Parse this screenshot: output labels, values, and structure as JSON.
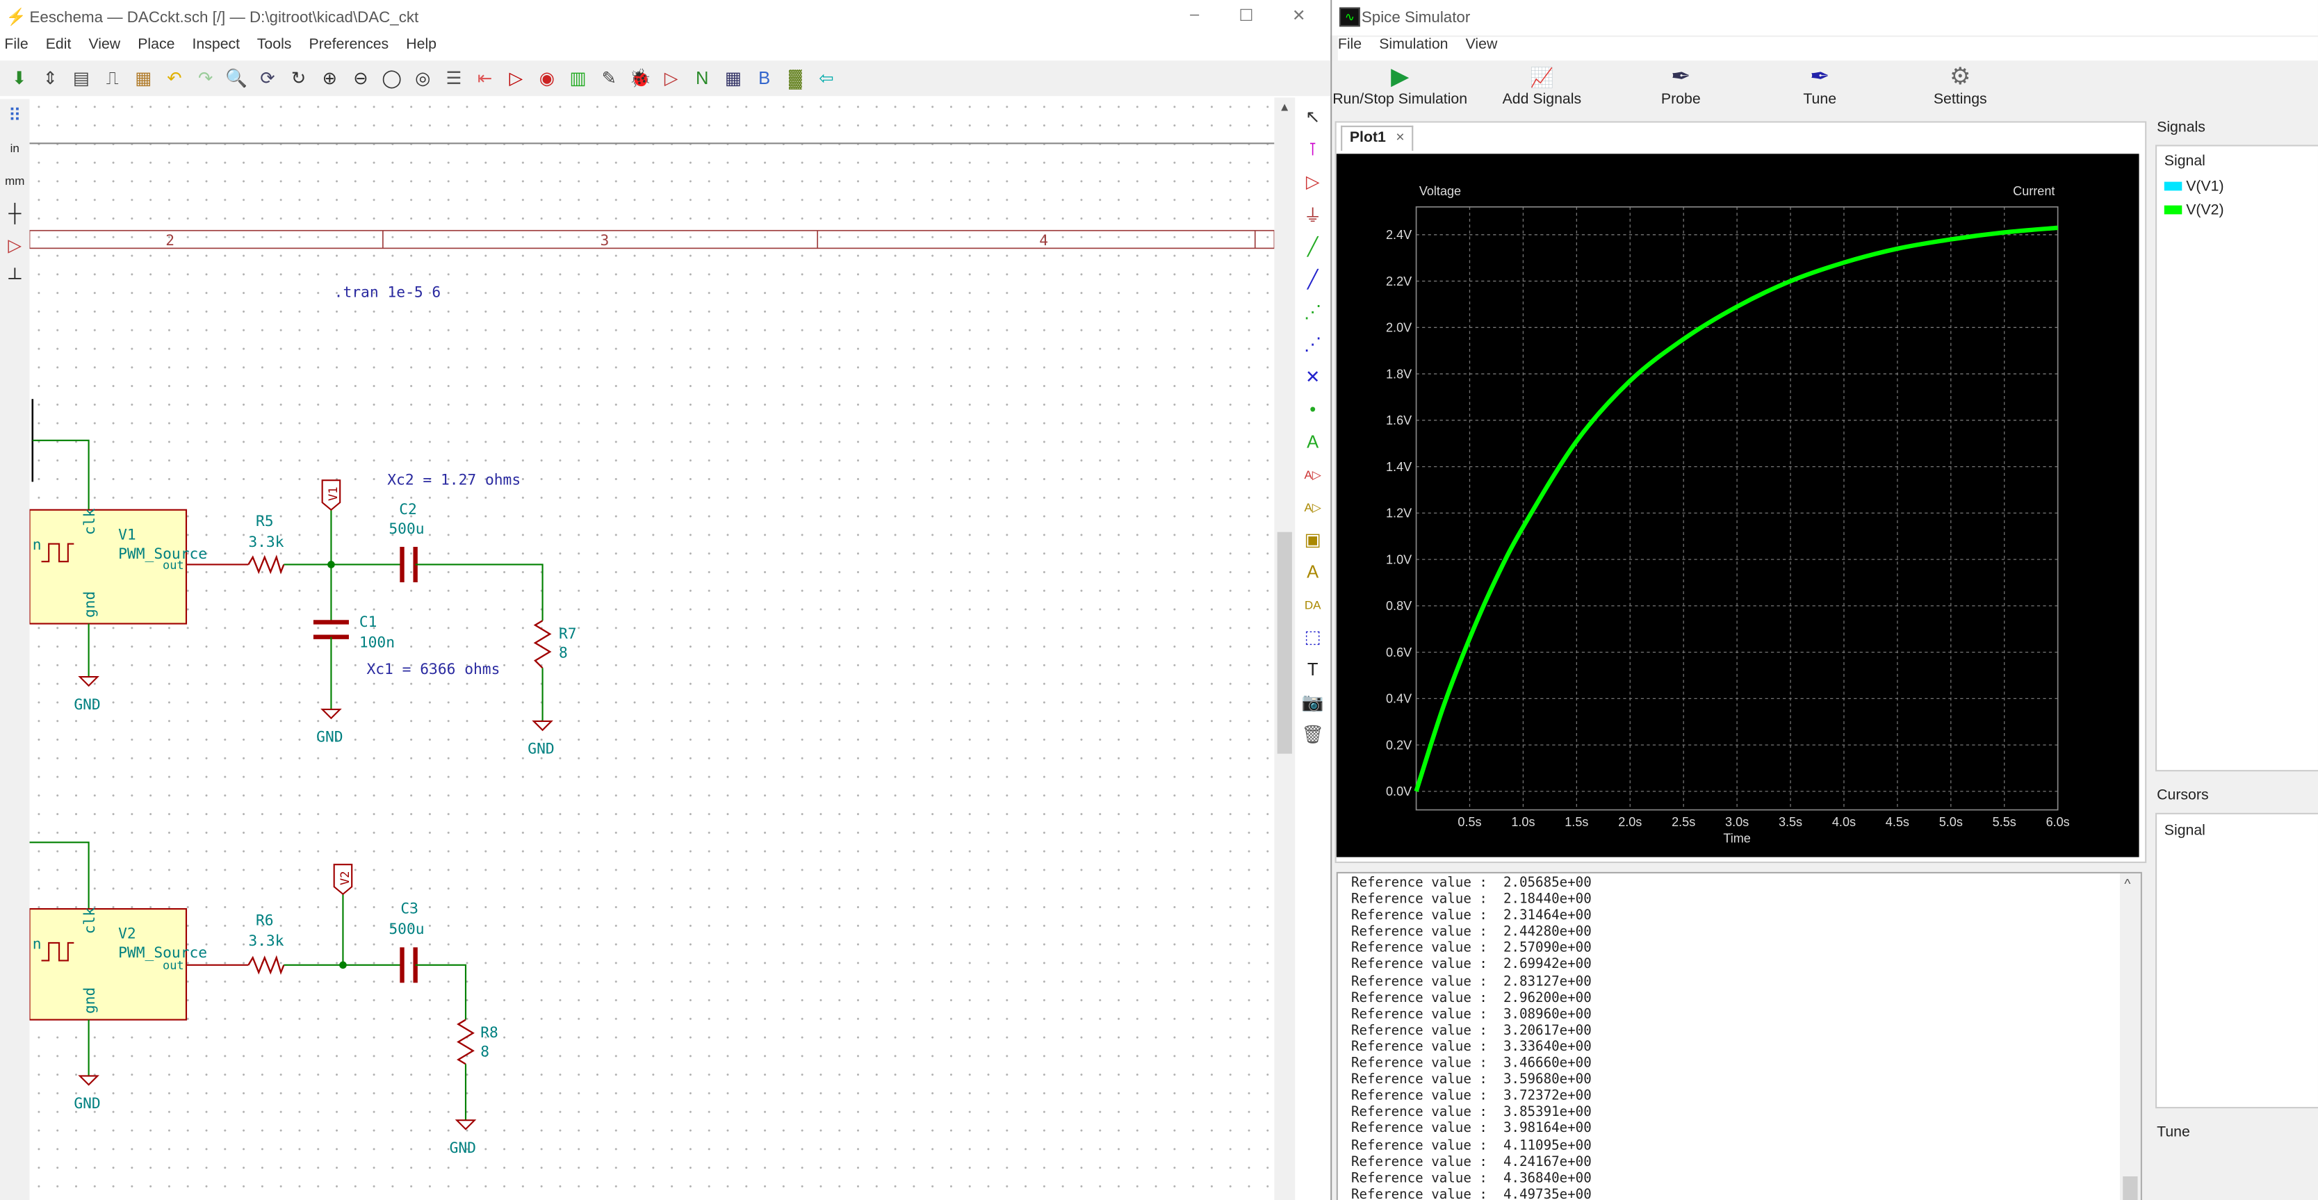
{
  "eeschema": {
    "title": "Eeschema — DACckt.sch [/] — D:\\gitroot\\kicad\\DAC_ckt",
    "window_controls": [
      "–",
      "☐",
      "✕"
    ],
    "menu": [
      "File",
      "Edit",
      "View",
      "Place",
      "Inspect",
      "Tools",
      "Preferences",
      "Help"
    ],
    "toolbar_icons": [
      {
        "name": "save-icon",
        "g": "⬇",
        "c": "#2a8a2a"
      },
      {
        "name": "page-settings-icon",
        "g": "⇕",
        "c": "#444"
      },
      {
        "name": "print-icon",
        "g": "▤",
        "c": "#444"
      },
      {
        "name": "plot-icon",
        "g": "⎍",
        "c": "#444"
      },
      {
        "name": "paste-icon",
        "g": "▦",
        "c": "#b07b2a"
      },
      {
        "name": "undo-icon",
        "g": "↶",
        "c": "#e0b000"
      },
      {
        "name": "redo-icon",
        "g": "↷",
        "c": "#9c9"
      },
      {
        "name": "find-icon",
        "g": "🔍",
        "c": "#446"
      },
      {
        "name": "find-replace-icon",
        "g": "⟳",
        "c": "#446"
      },
      {
        "name": "redraw-icon",
        "g": "↻",
        "c": "#333"
      },
      {
        "name": "zoom-in-icon",
        "g": "⊕",
        "c": "#333"
      },
      {
        "name": "zoom-out-icon",
        "g": "⊖",
        "c": "#333"
      },
      {
        "name": "zoom-fit-icon",
        "g": "◯",
        "c": "#333"
      },
      {
        "name": "zoom-selection-icon",
        "g": "◎",
        "c": "#333"
      },
      {
        "name": "hierarchy-icon",
        "g": "☰",
        "c": "#555"
      },
      {
        "name": "leave-sheet-icon",
        "g": "⇤",
        "c": "#d55"
      },
      {
        "name": "symbol-editor-icon",
        "g": "▷",
        "c": "#b00"
      },
      {
        "name": "symbol-browser-icon",
        "g": "◉",
        "c": "#c22"
      },
      {
        "name": "footprint-assign-icon",
        "g": "▥",
        "c": "#2a2"
      },
      {
        "name": "annotate-icon",
        "g": "✎",
        "c": "#444"
      },
      {
        "name": "erc-icon",
        "g": "🐞",
        "c": "#a00"
      },
      {
        "name": "simulator-icon",
        "g": "▷",
        "c": "#b33"
      },
      {
        "name": "netlist-icon",
        "g": "N",
        "c": "#2a8a2a"
      },
      {
        "name": "bom-table-icon",
        "g": "▦",
        "c": "#336"
      },
      {
        "name": "bom-icon",
        "g": "B",
        "c": "#36c"
      },
      {
        "name": "pcbnew-icon",
        "g": "▓",
        "c": "#5a7a10"
      },
      {
        "name": "back-annotate-icon",
        "g": "⇦",
        "c": "#0aa"
      }
    ],
    "left_tools": [
      {
        "name": "grid-toggle-icon",
        "g": "⠿",
        "c": "#36c"
      },
      {
        "name": "units-inch-icon",
        "g": "in",
        "c": "#222"
      },
      {
        "name": "units-mm-icon",
        "g": "mm",
        "c": "#222"
      },
      {
        "name": "cursor-shape-icon",
        "g": "┼",
        "c": "#222"
      },
      {
        "name": "hidden-pins-icon",
        "g": "▷",
        "c": "#b33"
      },
      {
        "name": "wire-angle-icon",
        "g": "┴",
        "c": "#222"
      }
    ],
    "right_tools": [
      {
        "name": "select-icon",
        "g": "↖",
        "c": "#333"
      },
      {
        "name": "highlight-net-icon",
        "g": "⊺",
        "c": "#c0c"
      },
      {
        "name": "add-symbol-icon",
        "g": "▷",
        "c": "#c33"
      },
      {
        "name": "add-power-icon",
        "g": "⏚",
        "c": "#a33"
      },
      {
        "name": "add-wire-icon",
        "g": "╱",
        "c": "#2a2"
      },
      {
        "name": "add-bus-icon",
        "g": "╱",
        "c": "#22c"
      },
      {
        "name": "wire-bus-entry-icon",
        "g": "⋰",
        "c": "#2a2"
      },
      {
        "name": "bus-bus-entry-icon",
        "g": "⋰",
        "c": "#22c"
      },
      {
        "name": "no-connect-icon",
        "g": "✕",
        "c": "#22c"
      },
      {
        "name": "add-junction-icon",
        "g": "•",
        "c": "#2a2"
      },
      {
        "name": "add-label-icon",
        "g": "A",
        "c": "#2a2"
      },
      {
        "name": "add-global-label-icon",
        "g": "A▷",
        "c": "#c33"
      },
      {
        "name": "add-hier-label-icon",
        "g": "A▷",
        "c": "#a80"
      },
      {
        "name": "add-sheet-icon",
        "g": "▣",
        "c": "#a80"
      },
      {
        "name": "import-sheet-pin-icon",
        "g": "A",
        "c": "#a80"
      },
      {
        "name": "add-sheet-pin-icon",
        "g": "DA",
        "c": "#a80"
      },
      {
        "name": "add-graphic-line-icon",
        "g": "⬚",
        "c": "#22c"
      },
      {
        "name": "add-text-icon",
        "g": "T",
        "c": "#222"
      },
      {
        "name": "add-image-icon",
        "g": "📷",
        "c": "#333"
      },
      {
        "name": "delete-icon",
        "g": "🗑",
        "c": "#555"
      }
    ],
    "sheet_columns": [
      "2",
      "3",
      "4"
    ],
    "directive": ".tran 1e-5 6",
    "circuit1": {
      "source_ref": "V1",
      "source_value": "PWM_Source",
      "pin_clk": "clk",
      "pin_gnd": "gnd",
      "pin_out": "out",
      "pin_n": "n",
      "r_ref": "R5",
      "r_value": "3.3k",
      "net_label": "V1",
      "c_series_ref": "C2",
      "c_series_value": "500u",
      "c_shunt_ref": "C1",
      "c_shunt_value": "100n",
      "load_ref": "R7",
      "load_value": "8",
      "note_xc2": "Xc2 = 1.27 ohms",
      "note_xc1": "Xc1 = 6366 ohms",
      "gnd": "GND"
    },
    "circuit2": {
      "source_ref": "V2",
      "source_value": "PWM_Source",
      "pin_clk": "clk",
      "pin_gnd": "gnd",
      "pin_out": "out",
      "pin_n": "n",
      "r_ref": "R6",
      "r_value": "3.3k",
      "net_label": "V2",
      "c_series_ref": "C3",
      "c_series_value": "500u",
      "load_ref": "R8",
      "load_value": "8",
      "gnd": "GND"
    }
  },
  "spice": {
    "title": "Spice Simulator",
    "window_controls": [
      "–",
      "☐",
      "✕"
    ],
    "menu": [
      "File",
      "Simulation",
      "View"
    ],
    "toolbar": [
      {
        "label": "Run/Stop Simulation",
        "icon": "play-icon",
        "g": "▶",
        "c": "#1a9a3a"
      },
      {
        "label": "Add Signals",
        "icon": "add-signals-icon",
        "g": "📈",
        "c": "#a33"
      },
      {
        "label": "Probe",
        "icon": "probe-icon",
        "g": "✒",
        "c": "#335"
      },
      {
        "label": "Tune",
        "icon": "tune-icon",
        "g": "✒",
        "c": "#22a"
      },
      {
        "label": "Settings",
        "icon": "settings-icon",
        "g": "⚙",
        "c": "#666"
      }
    ],
    "plot_tab": "Plot1",
    "signals_label": "Signals",
    "signals_header": "Signal",
    "signals": [
      {
        "name": "V(V1)",
        "color": "#00e5ff"
      },
      {
        "name": "V(V2)",
        "color": "#00ff00"
      }
    ],
    "cursors_label": "Cursors",
    "cursors_header": "Signal",
    "tune_label": "Tune",
    "console_lines": [
      "Reference value :  2.05685e+00",
      "Reference value :  2.18440e+00",
      "Reference value :  2.31464e+00",
      "Reference value :  2.44280e+00",
      "Reference value :  2.57090e+00",
      "Reference value :  2.69942e+00",
      "Reference value :  2.83127e+00",
      "Reference value :  2.96200e+00",
      "Reference value :  3.08960e+00",
      "Reference value :  3.20617e+00",
      "Reference value :  3.33640e+00",
      "Reference value :  3.46660e+00",
      "Reference value :  3.59680e+00",
      "Reference value :  3.72372e+00",
      "Reference value :  3.85391e+00",
      "Reference value :  3.98164e+00",
      "Reference value :  4.11095e+00",
      "Reference value :  4.24167e+00",
      "Reference value :  4.36840e+00",
      "Reference value :  4.49735e+00"
    ]
  },
  "chart_data": {
    "type": "line",
    "xlabel": "Time",
    "ylabel": "Voltage",
    "y2label": "Current",
    "xlim": [
      0,
      6.0
    ],
    "ylim": [
      -0.08,
      2.52
    ],
    "xticks": [
      "0.5s",
      "1.0s",
      "1.5s",
      "2.0s",
      "2.5s",
      "3.0s",
      "3.5s",
      "4.0s",
      "4.5s",
      "5.0s",
      "5.5s",
      "6.0s"
    ],
    "xtick_values": [
      0.5,
      1.0,
      1.5,
      2.0,
      2.5,
      3.0,
      3.5,
      4.0,
      4.5,
      5.0,
      5.5,
      6.0
    ],
    "yticks": [
      "0.0V",
      "0.2V",
      "0.4V",
      "0.6V",
      "0.8V",
      "1.0V",
      "1.2V",
      "1.4V",
      "1.6V",
      "1.8V",
      "2.0V",
      "2.2V",
      "2.4V"
    ],
    "ytick_values": [
      0,
      0.2,
      0.4,
      0.6,
      0.8,
      1.0,
      1.2,
      1.4,
      1.6,
      1.8,
      2.0,
      2.2,
      2.4
    ],
    "grid": true,
    "background": "#000000",
    "series": [
      {
        "name": "V(V2)",
        "color": "#00ff00",
        "x": [
          0,
          0.25,
          0.5,
          0.75,
          1.0,
          1.5,
          2.0,
          2.5,
          3.0,
          3.5,
          4.0,
          4.5,
          5.0,
          5.5,
          6.0
        ],
        "y": [
          0,
          0.36,
          0.66,
          0.92,
          1.14,
          1.51,
          1.77,
          1.95,
          2.09,
          2.2,
          2.28,
          2.34,
          2.38,
          2.41,
          2.43
        ]
      }
    ]
  }
}
